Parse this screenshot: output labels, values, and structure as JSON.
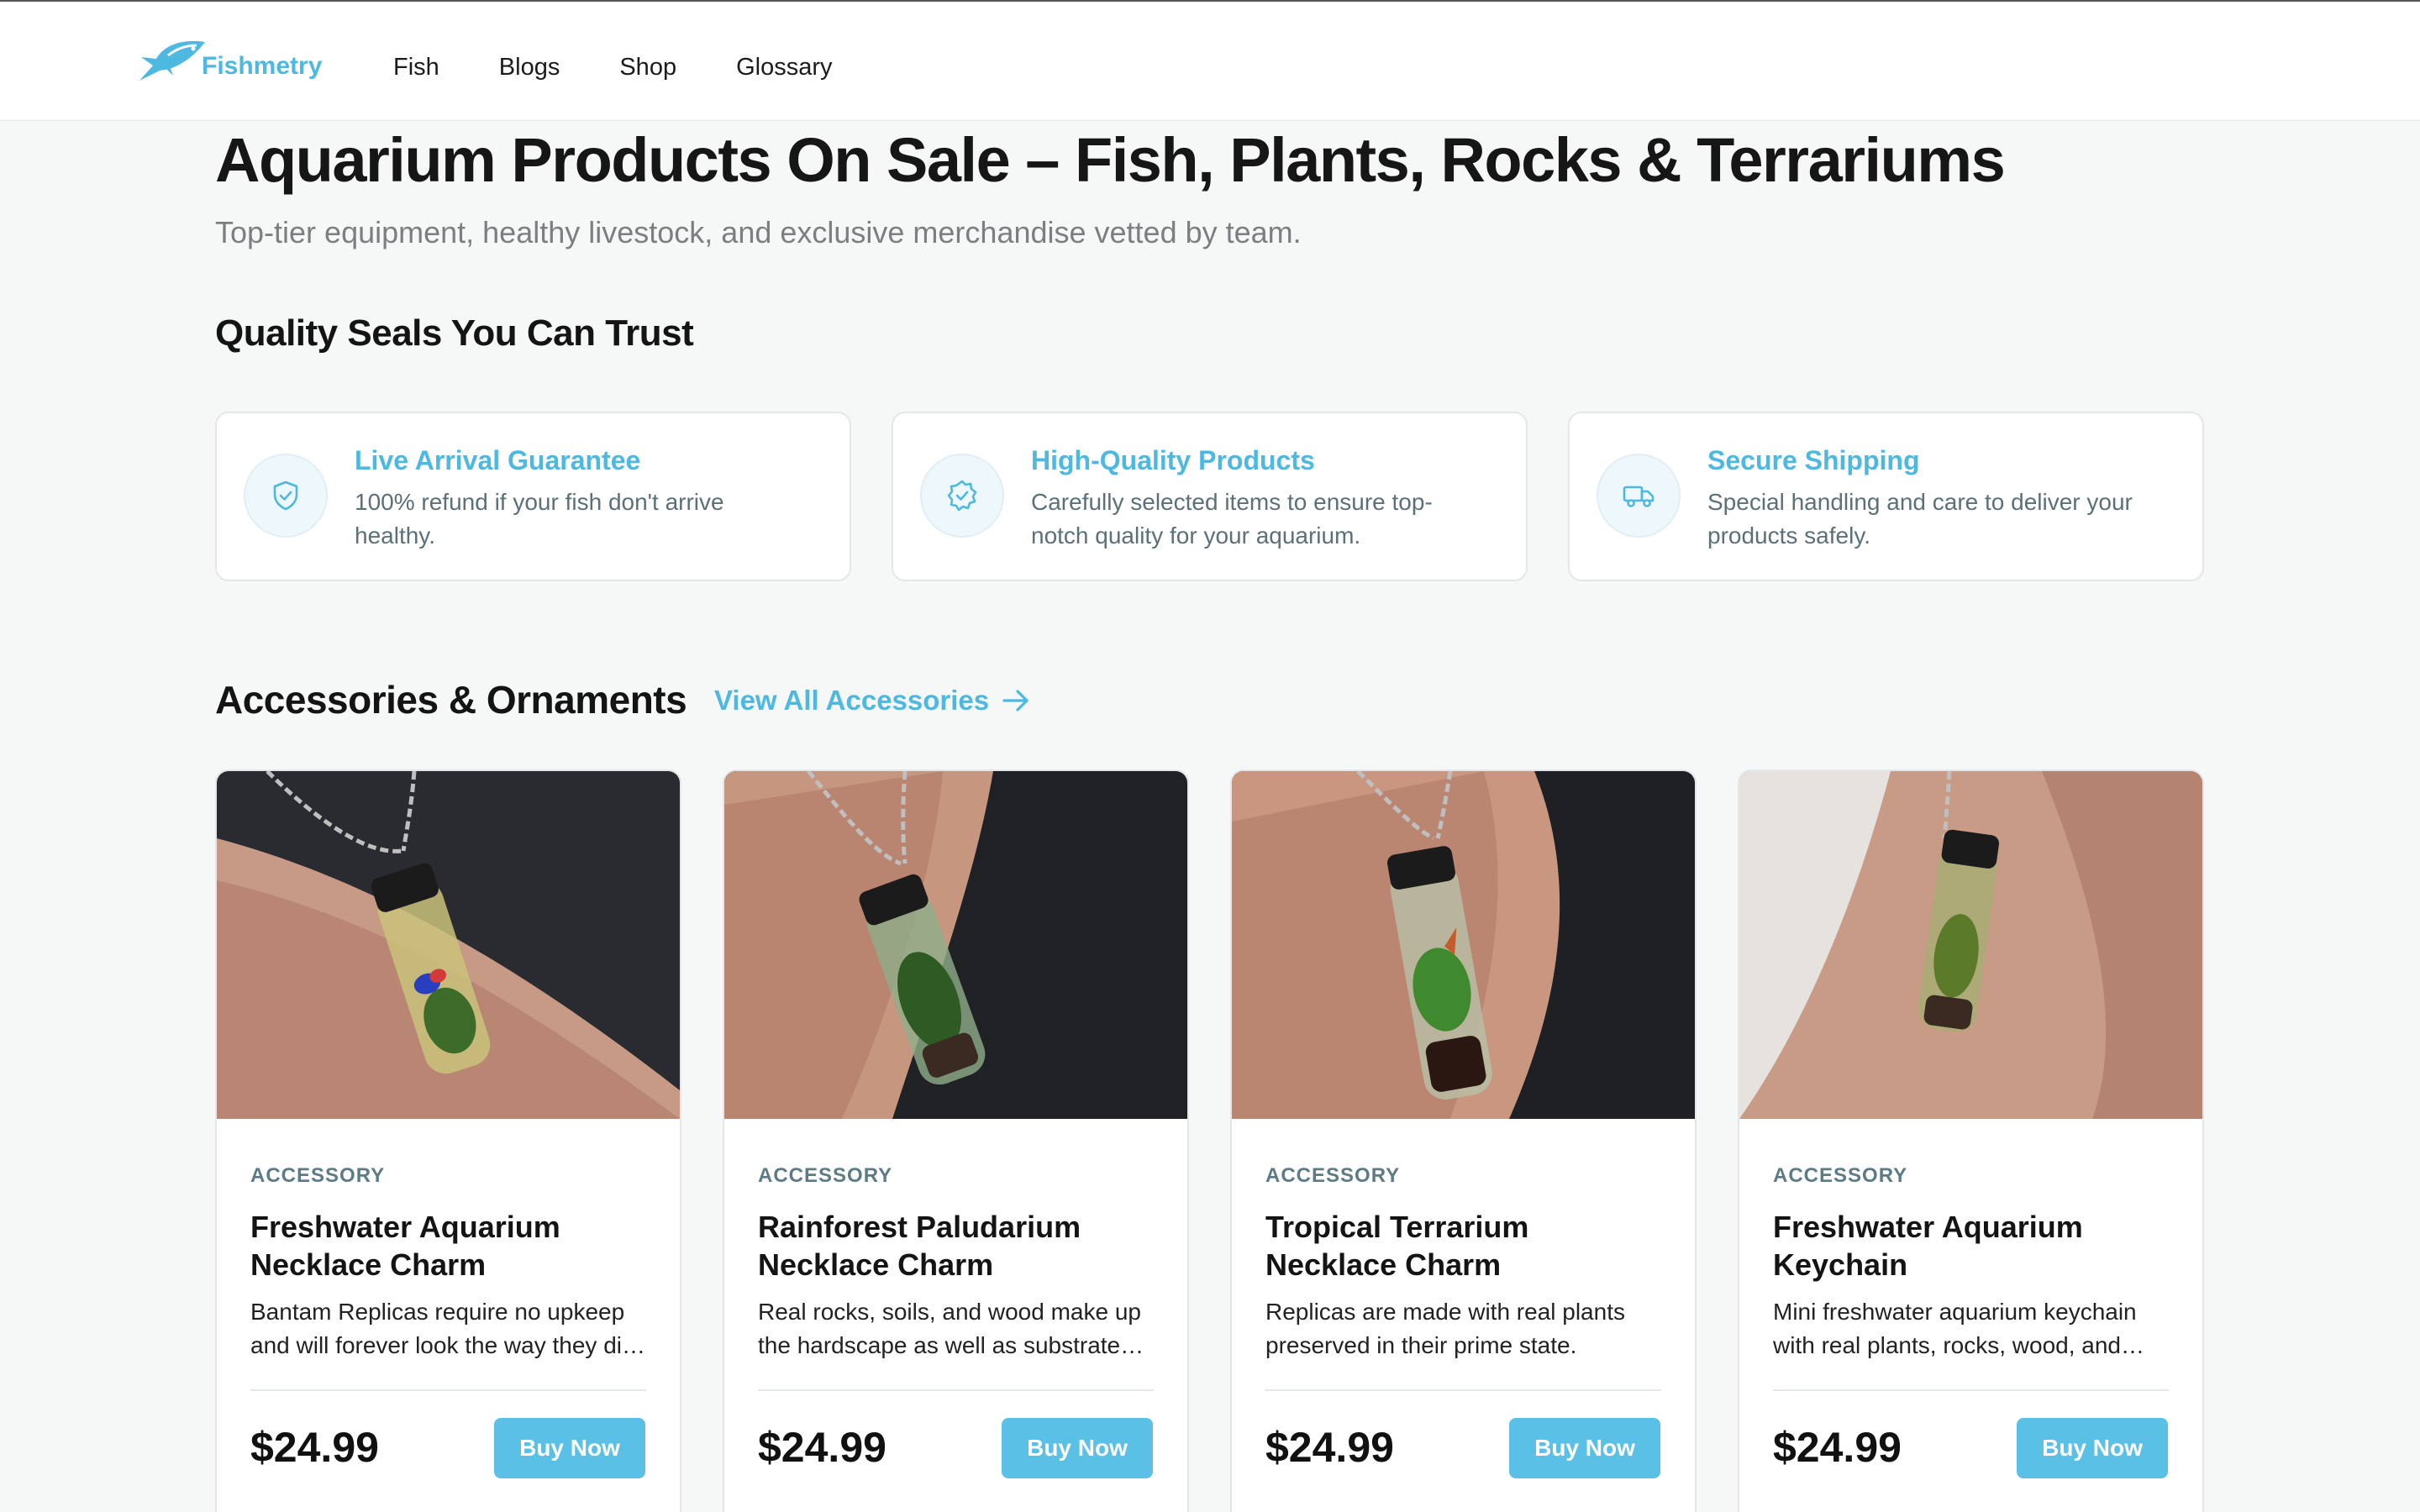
{
  "brand": {
    "name": "Fishmetry",
    "accent": "#4db8e0"
  },
  "nav": {
    "links": [
      "Fish",
      "Blogs",
      "Shop",
      "Glossary"
    ]
  },
  "hero": {
    "title": "Aquarium Products On Sale – Fish, Plants, Rocks & Terrariums",
    "subtitle": "Top-tier equipment, healthy livestock, and exclusive merchandise vetted by team."
  },
  "seals": {
    "heading": "Quality Seals You Can Trust",
    "items": [
      {
        "title": "Live Arrival Guarantee",
        "desc": "100% refund if your fish don't arrive healthy.",
        "icon": "shield-check-icon"
      },
      {
        "title": "High-Quality Products",
        "desc": "Carefully selected items to ensure top-notch quality for your aquarium.",
        "icon": "badge-check-icon"
      },
      {
        "title": "Secure Shipping",
        "desc": "Special handling and care to deliver your products safely.",
        "icon": "truck-icon"
      }
    ]
  },
  "accessories": {
    "heading": "Accessories & Ornaments",
    "view_all": "View All Accessories",
    "products": [
      {
        "category": "ACCESSORY",
        "name": "Freshwater Aquarium Necklace Charm",
        "desc": "Bantam Replicas require no upkeep and will forever look the way they did the day they were made.",
        "price": "$24.99",
        "button": "Buy Now"
      },
      {
        "category": "ACCESSORY",
        "name": "Rainforest Paludarium Necklace Charm",
        "desc": "Real rocks, soils, and wood make up the hardscape as well as substrate layers.",
        "price": "$24.99",
        "button": "Buy Now"
      },
      {
        "category": "ACCESSORY",
        "name": "Tropical Terrarium Necklace Charm",
        "desc": "Replicas are made with real plants preserved in their prime state.",
        "price": "$24.99",
        "button": "Buy Now"
      },
      {
        "category": "ACCESSORY",
        "name": "Freshwater Aquarium Keychain",
        "desc": "Mini freshwater aquarium keychain with real plants, rocks, wood, and more.",
        "price": "$24.99",
        "button": "Buy Now"
      }
    ]
  }
}
